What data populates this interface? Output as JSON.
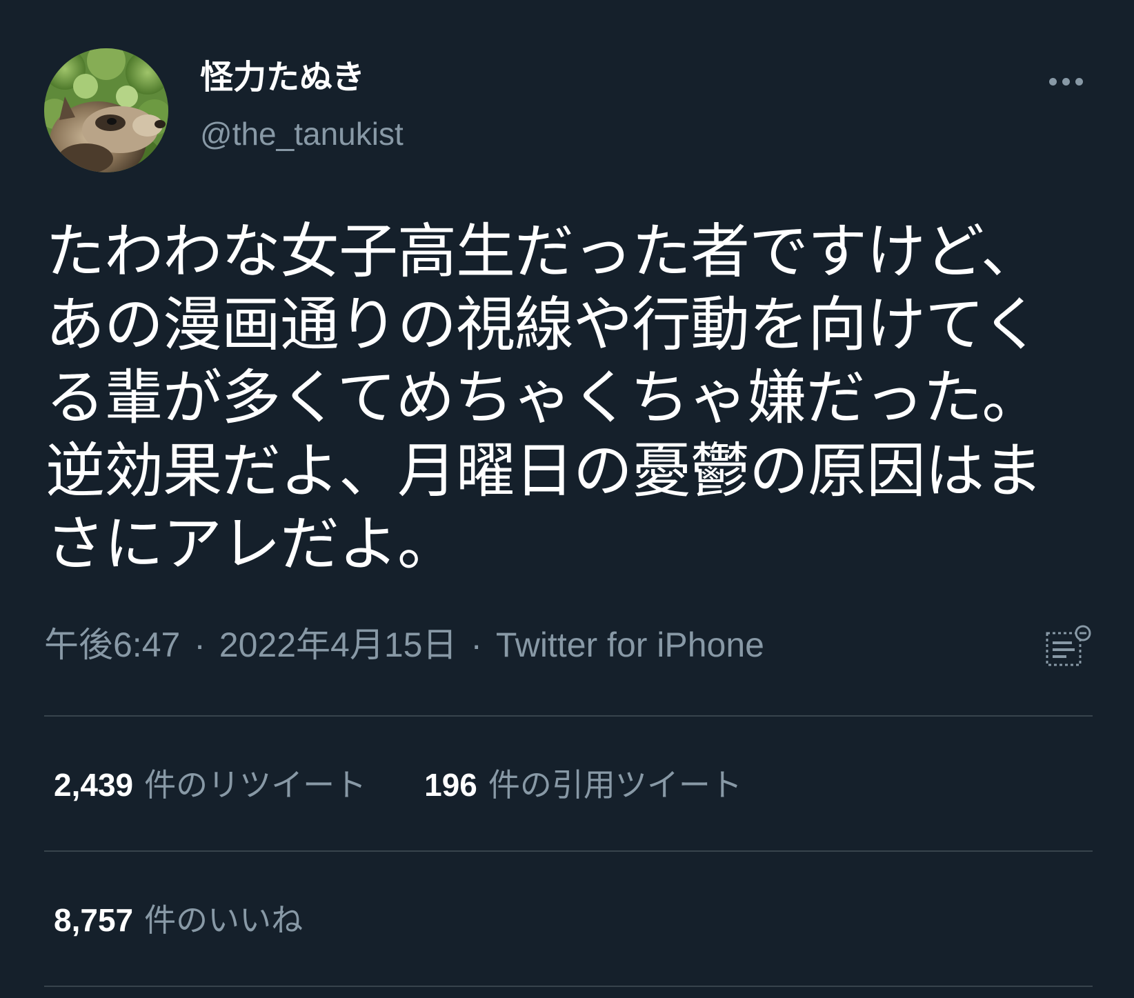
{
  "author": {
    "display_name": "怪力たぬき",
    "handle": "@the_tanukist"
  },
  "tweet": {
    "lines": [
      "たわわな女子高生だった者ですけど、",
      "あの漫画通りの視線や行動を向けてく",
      "る輩が多くてめちゃくちゃ嫌だった。",
      "逆効果だよ、月曜日の憂鬱の原因はま",
      "さにアレだよ。"
    ]
  },
  "meta": {
    "time": "午後6:47",
    "date": "2022年4月15日",
    "separator": "·",
    "source": "Twitter for iPhone"
  },
  "stats": {
    "retweets": {
      "count": "2,439",
      "label": "件のリツイート"
    },
    "quotes": {
      "count": "196",
      "label": "件の引用ツイート"
    },
    "likes": {
      "count": "8,757",
      "label": "件のいいね"
    }
  },
  "icons": {
    "more": "more-options-icon",
    "analytics": "tweet-analytics-icon"
  },
  "colors": {
    "background": "#15202b",
    "text_primary": "#ffffff",
    "text_secondary": "#8899a6",
    "divider": "#38444d"
  }
}
